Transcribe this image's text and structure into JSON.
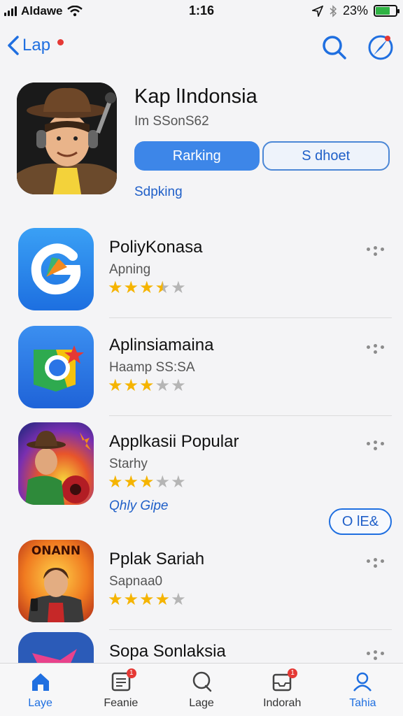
{
  "status_bar": {
    "carrier": "Aldawe",
    "time": "1:16",
    "battery": "23%",
    "battery_level": 0.7
  },
  "nav": {
    "back_label": "Lap",
    "search_icon": "search-icon",
    "compass_icon": "compass-icon"
  },
  "hero": {
    "title": "Kap lIndonsia",
    "subtitle": "Im SSonS62",
    "tab_active": "Rarking",
    "tab_inactive": "S dhoet",
    "link": "Sdpking"
  },
  "apps": [
    {
      "name": "PoliyKonasa",
      "subtitle": "Apning",
      "rating": 3.5,
      "icon": "swirl-g-icon"
    },
    {
      "name": "Aplinsiamaina",
      "subtitle": "Haamp SS:SA",
      "rating": 3,
      "icon": "chrome-like-icon"
    },
    {
      "name": "Applkasii Popular",
      "subtitle": "Starhy",
      "rating": 3,
      "icon": "cowboy-art-icon",
      "extra_link": "Qhly Gipe",
      "action_button": "O lE&"
    },
    {
      "name": "Pplak Sariah",
      "subtitle": "Sapnaa0",
      "rating": 4,
      "icon": "poster-art-icon",
      "banner": "ONANN"
    },
    {
      "name": "Sopa Sonlaksia",
      "subtitle": "",
      "rating": 0,
      "icon": "pink-star-icon"
    }
  ],
  "tabs": [
    {
      "label": "Laye",
      "icon": "home-icon",
      "active": true,
      "badge": ""
    },
    {
      "label": "Feanie",
      "icon": "news-icon",
      "active": false,
      "badge": "1"
    },
    {
      "label": "Lage",
      "icon": "search-icon",
      "active": false,
      "badge": ""
    },
    {
      "label": "Indorah",
      "icon": "inbox-icon",
      "active": false,
      "badge": "1"
    },
    {
      "label": "Tahia",
      "icon": "person-icon",
      "active": false,
      "badge": ""
    }
  ],
  "colors": {
    "accent": "#1f6fe0",
    "star": "#f5b400",
    "badge": "#e53935"
  }
}
